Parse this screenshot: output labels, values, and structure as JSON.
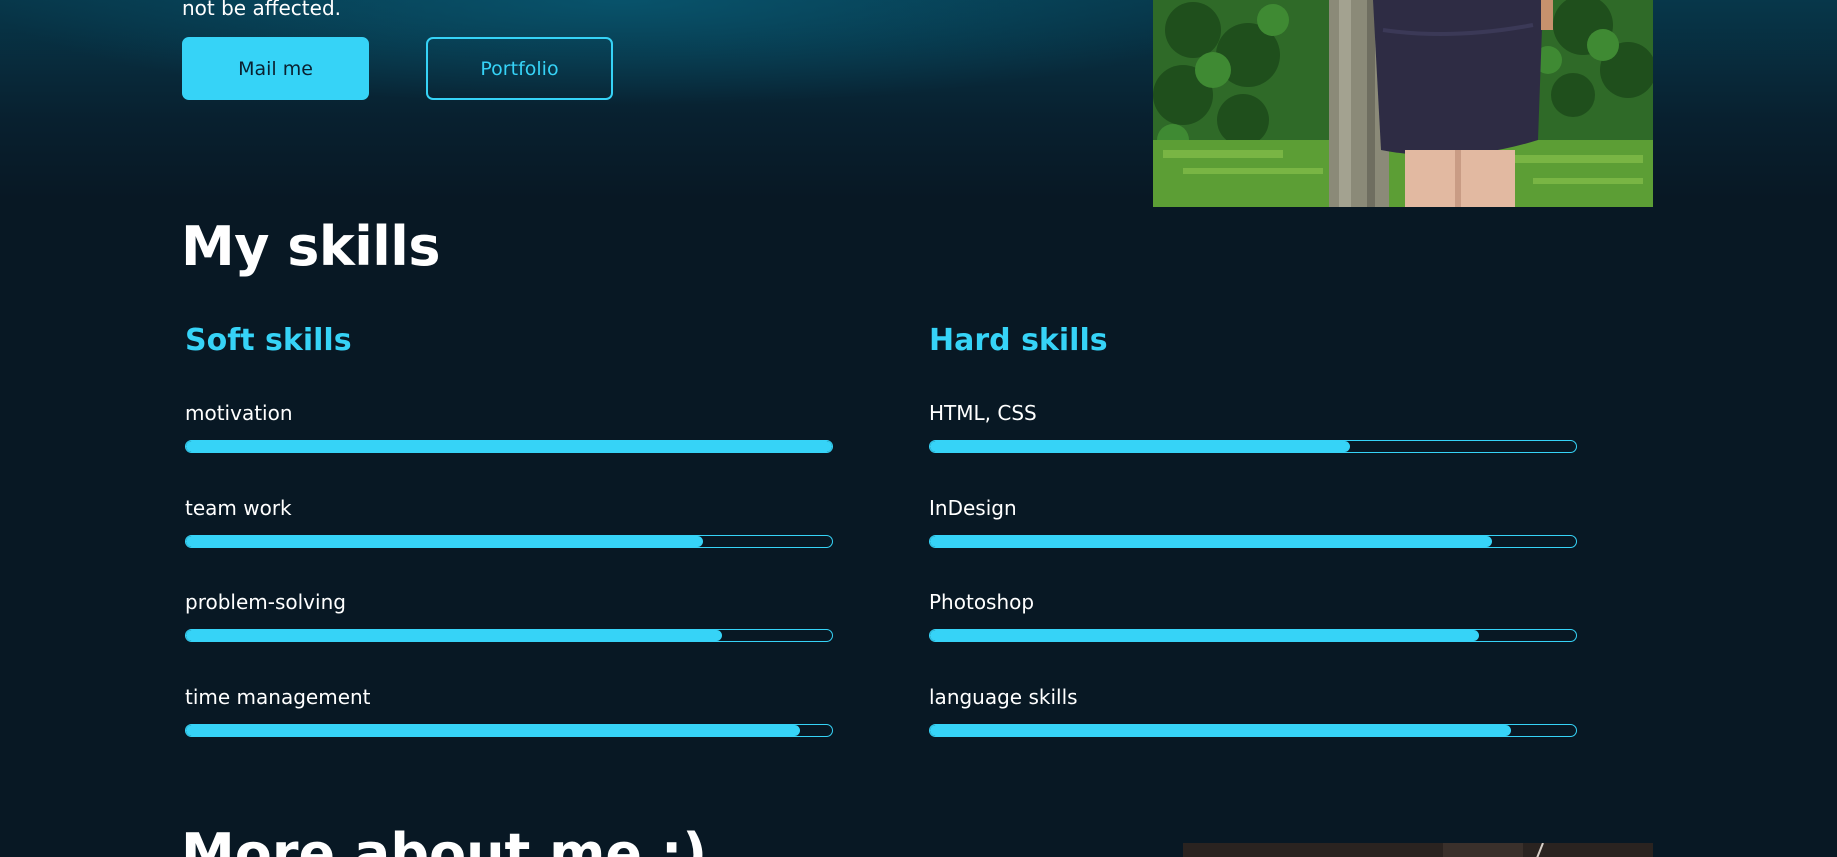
{
  "hero": {
    "text": "not be affected.",
    "mail_button": "Mail me",
    "portfolio_button": "Portfolio"
  },
  "skills": {
    "title": "My skills",
    "soft": {
      "title": "Soft skills",
      "items": [
        {
          "label": "motivation",
          "percent": 100
        },
        {
          "label": "team work",
          "percent": 80
        },
        {
          "label": "problem-solving",
          "percent": 83
        },
        {
          "label": "time management",
          "percent": 95
        }
      ]
    },
    "hard": {
      "title": "Hard skills",
      "items": [
        {
          "label": "HTML, CSS",
          "percent": 65
        },
        {
          "label": "InDesign",
          "percent": 87
        },
        {
          "label": "Photoshop",
          "percent": 85
        },
        {
          "label": "language skills",
          "percent": 90
        }
      ]
    }
  },
  "more": {
    "title": "More about me :)"
  },
  "colors": {
    "accent": "#36d3f7",
    "background": "#081824",
    "text": "#ffffff"
  }
}
